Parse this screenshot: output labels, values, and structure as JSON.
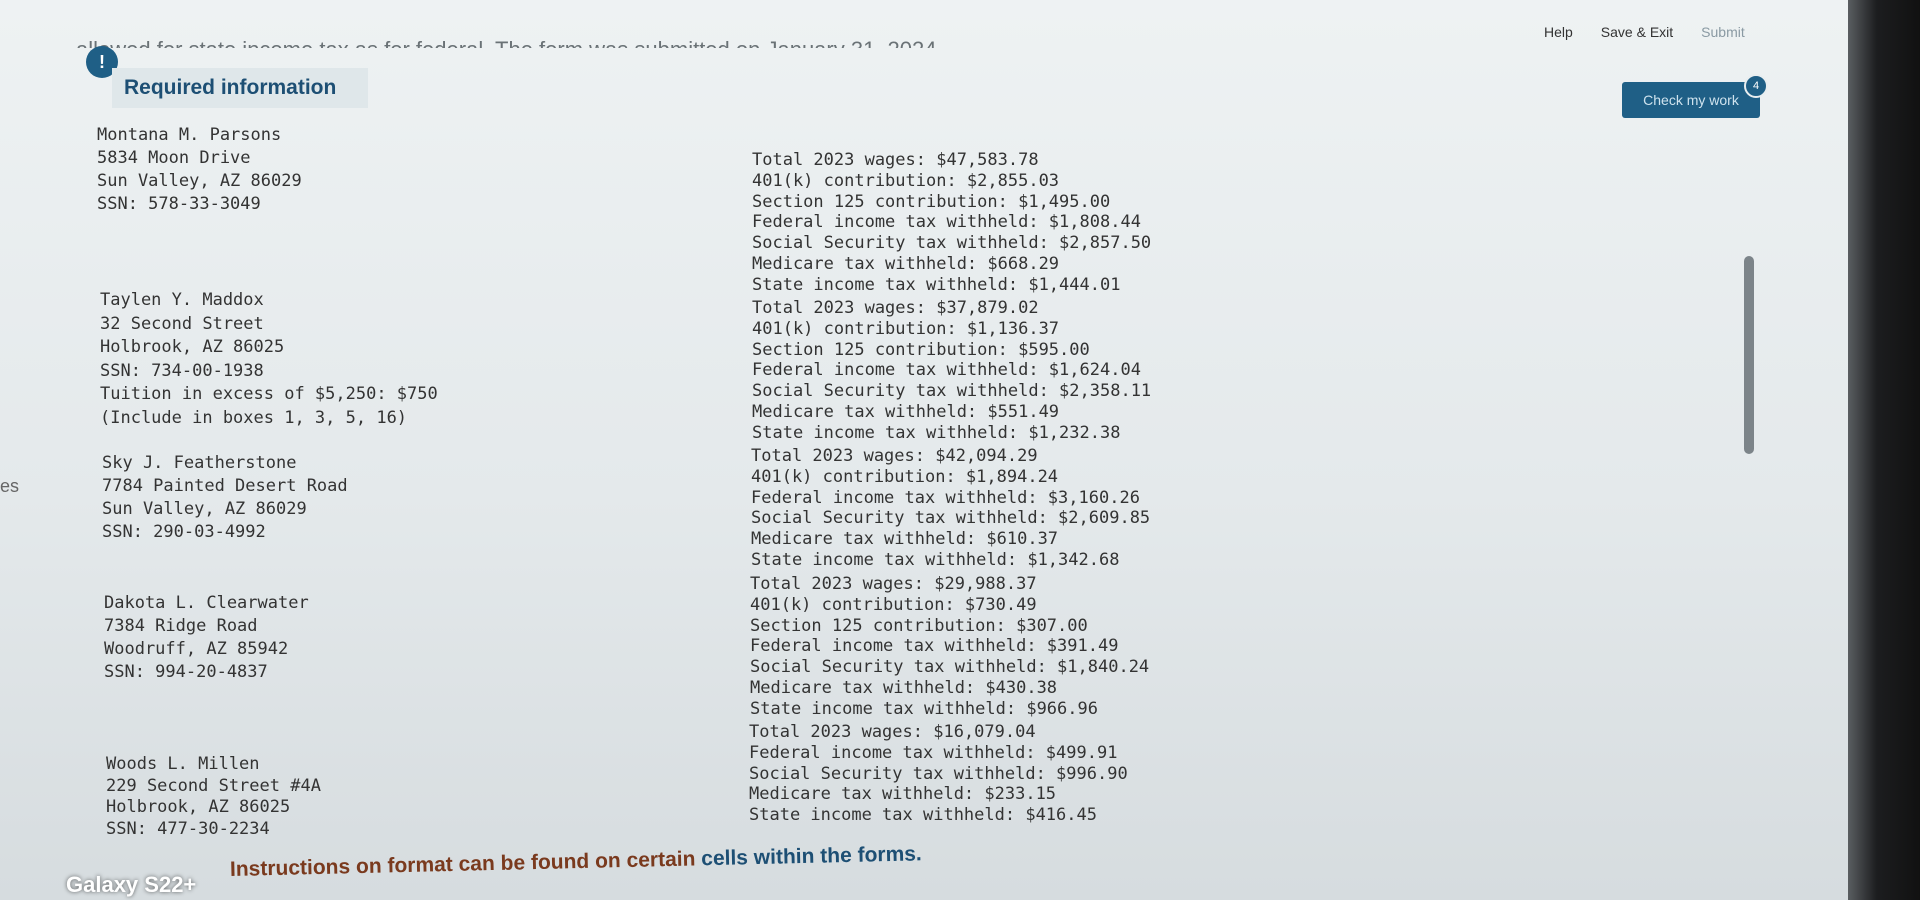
{
  "top_links": {
    "help": "Help",
    "save_exit": "Save & Exit",
    "submit": "Submit"
  },
  "check_button": {
    "label": "Check my work",
    "badge": "4"
  },
  "cutoff_text": "allowed for state income tax as for federal. The form was submitted on January 31, 2024",
  "required_info": "Required information",
  "side_fragment": "es",
  "employees": [
    {
      "name": "Montana M. Parsons",
      "address": "5834 Moon Drive",
      "city": "Sun Valley, AZ 86029",
      "ssn": "SSN: 578-33-3049",
      "extra": []
    },
    {
      "name": "Taylen Y. Maddox",
      "address": "32 Second Street",
      "city": "Holbrook, AZ 86025",
      "ssn": "SSN: 734-00-1938",
      "extra": [
        "Tuition in excess of $5,250: $750",
        "(Include in boxes 1, 3, 5, 16)"
      ]
    },
    {
      "name": "Sky J. Featherstone",
      "address": "7784 Painted Desert Road",
      "city": "Sun Valley, AZ 86029",
      "ssn": "SSN: 290-03-4992",
      "extra": []
    },
    {
      "name": "Dakota L. Clearwater",
      "address": "7384 Ridge Road",
      "city": "Woodruff, AZ 85942",
      "ssn": "SSN: 994-20-4837",
      "extra": []
    },
    {
      "name": "Woods L. Millen",
      "address": "229 Second Street #4A",
      "city": "Holbrook, AZ 86025",
      "ssn": "SSN: 477-30-2234",
      "extra": []
    }
  ],
  "payroll": [
    [
      "Total 2023 wages: $47,583.78",
      "401(k) contribution: $2,855.03",
      "Section 125 contribution: $1,495.00",
      "Federal income tax withheld: $1,808.44",
      "Social Security tax withheld: $2,857.50",
      "Medicare tax withheld: $668.29",
      "State income tax withheld: $1,444.01"
    ],
    [
      "Total 2023 wages: $37,879.02",
      "401(k) contribution: $1,136.37",
      "Section 125 contribution: $595.00",
      "Federal income tax withheld: $1,624.04",
      "Social Security tax withheld: $2,358.11",
      "Medicare tax withheld: $551.49",
      "State income tax withheld: $1,232.38"
    ],
    [
      "Total 2023 wages: $42,094.29",
      "401(k) contribution: $1,894.24",
      "Federal income tax withheld: $3,160.26",
      "Social Security tax withheld: $2,609.85",
      "Medicare tax withheld: $610.37",
      "State income tax withheld: $1,342.68"
    ],
    [
      "Total 2023 wages: $29,988.37",
      "401(k) contribution: $730.49",
      "Section 125 contribution: $307.00",
      "Federal income tax withheld: $391.49",
      "Social Security tax withheld: $1,840.24",
      "Medicare tax withheld: $430.38",
      "State income tax withheld: $966.96"
    ],
    [
      "Total 2023 wages: $16,079.04",
      "Federal income tax withheld: $499.91",
      "Social Security tax withheld: $996.90",
      "Medicare tax withheld: $233.15",
      "State income tax withheld: $416.45"
    ]
  ],
  "bottom_note_prefix": "Instructions on format can be found on certain ",
  "bottom_note_highlight": "cells within the forms.",
  "watermark": "Galaxy S22+"
}
